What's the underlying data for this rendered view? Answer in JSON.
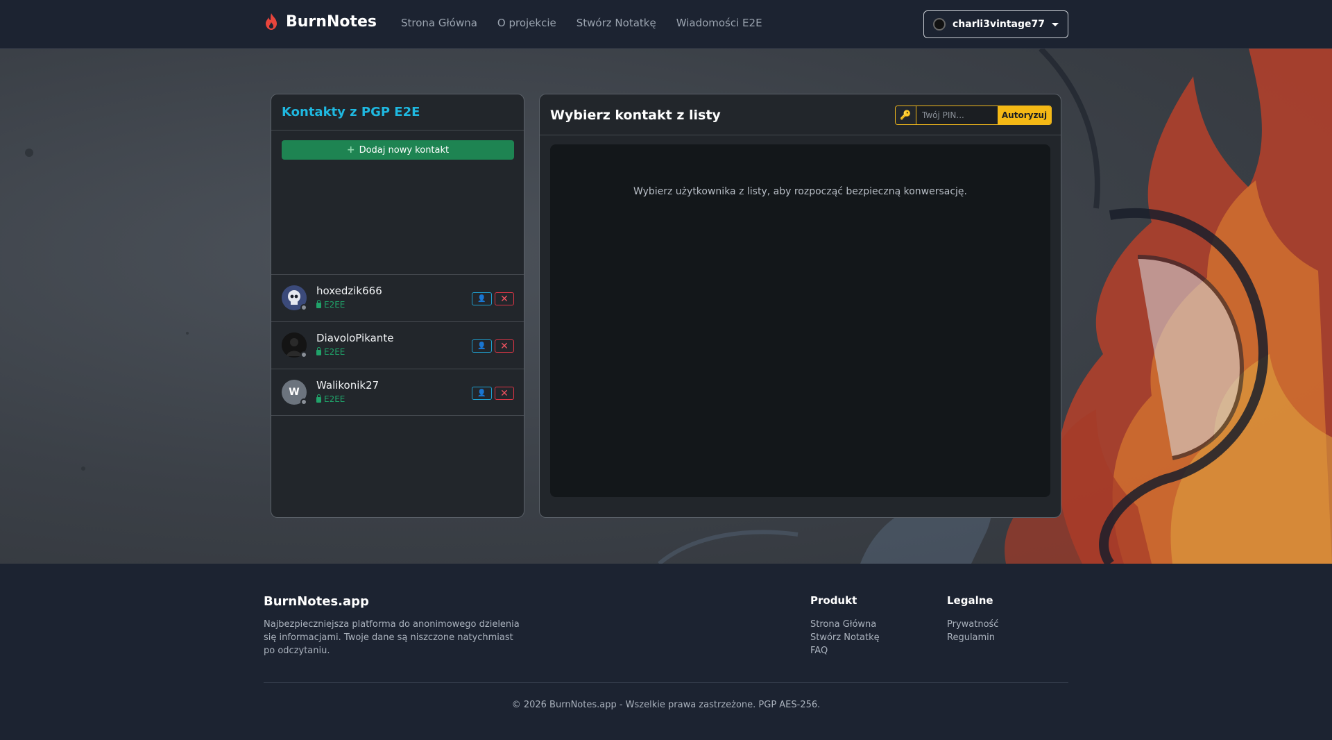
{
  "navbar": {
    "brand": "BurnNotes",
    "links": [
      "Strona Główna",
      "O projekcie",
      "Stwórz Notatkę",
      "Wiadomości E2E"
    ],
    "username": "charli3vintage77"
  },
  "contacts": {
    "title": "Kontakty z PGP E2E",
    "add_button": "Dodaj nowy kontakt",
    "items": [
      {
        "name": "hoxedzik666",
        "badge": "E2EE",
        "initial": ""
      },
      {
        "name": "DiavoloPikante",
        "badge": "E2EE",
        "initial": ""
      },
      {
        "name": "Walikonik27",
        "badge": "E2EE",
        "initial": "W"
      }
    ],
    "profile_icon": "👤",
    "remove_icon": "✕"
  },
  "chat": {
    "title": "Wybierz kontakt z listy",
    "pin_placeholder": "Twój PIN...",
    "pin_button": "Autoryzuj",
    "placeholder": "Wybierz użytkownika z listy, aby rozpocząć bezpieczną konwersację."
  },
  "footer": {
    "brand": "BurnNotes.app",
    "description": "Najbezpieczniejsza platforma do anonimowego dzielenia się informacjami. Twoje dane są niszczone natychmiast po odczytaniu.",
    "product": {
      "title": "Produkt",
      "links": [
        "Strona Główna",
        "Stwórz Notatkę",
        "FAQ"
      ]
    },
    "legal": {
      "title": "Legalne",
      "links": [
        "Prywatność",
        "Regulamin"
      ]
    },
    "copyright": "© 2026 BurnNotes.app - Wszelkie prawa zastrzeżone. PGP AES-256."
  },
  "colors": {
    "accent_cyan": "#1fb8e0",
    "success": "#1e8452",
    "warning": "#f5b915",
    "danger": "#dc3545",
    "flame": "#e8453c"
  }
}
